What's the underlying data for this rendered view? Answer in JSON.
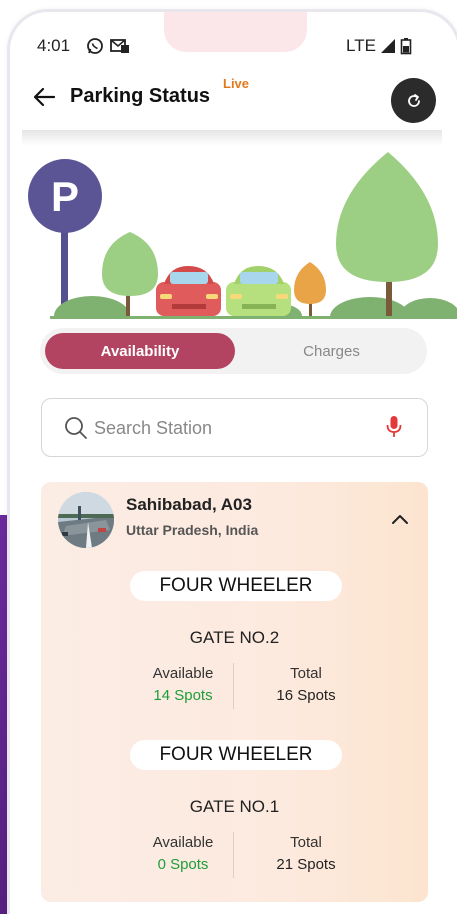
{
  "status_bar": {
    "time": "4:01",
    "network": "LTE",
    "icons": [
      "whatsapp-icon",
      "message-icon",
      "signal-icon",
      "battery-icon"
    ]
  },
  "header": {
    "title": "Parking Status",
    "badge": "Live",
    "refresh_icon": "refresh-icon",
    "back_icon": "back-arrow-icon"
  },
  "illustration": {
    "sign_letter": "P"
  },
  "tabs": {
    "active": "Availability",
    "inactive": "Charges"
  },
  "search": {
    "placeholder": "Search Station",
    "icon": "search-icon",
    "mic_icon": "microphone-icon"
  },
  "station": {
    "name": "Sahibabad, A03",
    "region": "Uttar Pradesh, India",
    "gates": [
      {
        "vehicle": "FOUR WHEELER",
        "gate": "GATE NO.2",
        "available_label": "Available",
        "available_value": "14 Spots",
        "total_label": "Total",
        "total_value": "16 Spots"
      },
      {
        "vehicle": "FOUR WHEELER",
        "gate": "GATE NO.1",
        "available_label": "Available",
        "available_value": "0 Spots",
        "total_label": "Total",
        "total_value": "21 Spots"
      }
    ]
  },
  "colors": {
    "accent": "#b24461",
    "live": "#e07a1f",
    "available_green": "#1f9d3a",
    "purple_bg": "#6a2a9c"
  }
}
